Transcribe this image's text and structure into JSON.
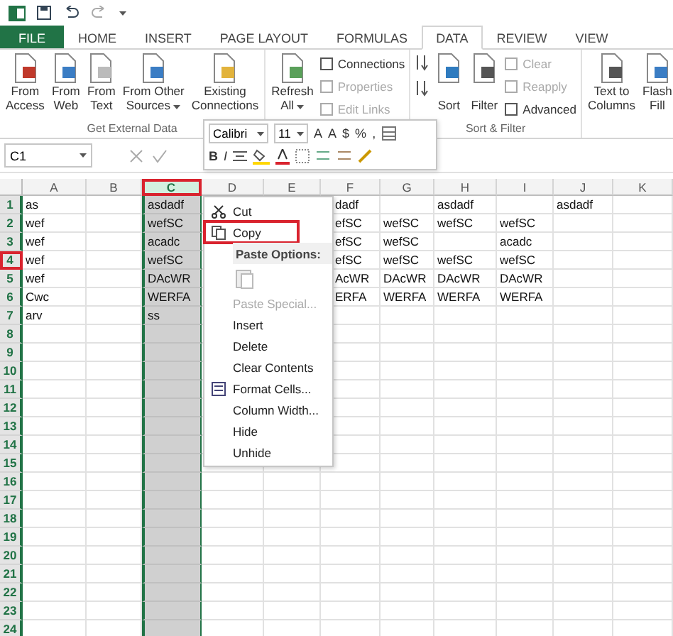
{
  "tabs": [
    {
      "label": "FILE",
      "kind": "file",
      "selected": false
    },
    {
      "label": "HOME",
      "kind": "tab",
      "selected": false
    },
    {
      "label": "INSERT",
      "kind": "tab",
      "selected": false
    },
    {
      "label": "PAGE LAYOUT",
      "kind": "tab",
      "selected": false
    },
    {
      "label": "FORMULAS",
      "kind": "tab",
      "selected": false
    },
    {
      "label": "DATA",
      "kind": "tab",
      "selected": true
    },
    {
      "label": "REVIEW",
      "kind": "tab",
      "selected": false
    },
    {
      "label": "VIEW",
      "kind": "tab",
      "selected": false
    }
  ],
  "ribbon": [
    {
      "label": "Get External Data",
      "items": [
        {
          "kind": "large",
          "lines": [
            "From",
            "Access"
          ],
          "dropdown": false
        },
        {
          "kind": "large",
          "lines": [
            "From",
            "Web"
          ],
          "dropdown": false
        },
        {
          "kind": "large",
          "lines": [
            "From",
            "Text"
          ],
          "dropdown": false
        },
        {
          "kind": "large",
          "lines": [
            "From Other",
            "Sources"
          ],
          "dropdown": true
        },
        {
          "kind": "large",
          "lines": [
            "Existing",
            "Connections"
          ],
          "dropdown": false
        }
      ]
    },
    {
      "items": [
        {
          "kind": "large",
          "lines": [
            "Refresh",
            "All"
          ],
          "dropdown": true
        },
        {
          "kind": "stack",
          "entries": [
            {
              "label": "Connections",
              "disabled": false
            },
            {
              "label": "Properties",
              "disabled": true
            },
            {
              "label": "Edit Links",
              "disabled": true
            }
          ]
        }
      ]
    },
    {
      "label": "Sort & Filter",
      "items": [
        {
          "kind": "sortpair"
        },
        {
          "kind": "large",
          "lines": [
            "Sort"
          ],
          "dropdown": false
        },
        {
          "kind": "large",
          "lines": [
            "Filter"
          ],
          "dropdown": false
        },
        {
          "kind": "stack",
          "entries": [
            {
              "label": "Clear",
              "disabled": true
            },
            {
              "label": "Reapply",
              "disabled": true
            },
            {
              "label": "Advanced",
              "disabled": false
            }
          ]
        }
      ]
    },
    {
      "items": [
        {
          "kind": "large",
          "lines": [
            "Text to",
            "Columns"
          ],
          "dropdown": false
        },
        {
          "kind": "large",
          "lines": [
            "Flash",
            "Fill"
          ],
          "dropdown": false
        }
      ]
    }
  ],
  "name_box": "C1",
  "mini_toolbar": {
    "font": "Calibri",
    "size": "11",
    "grow": [
      "A",
      "A"
    ],
    "symbols": [
      "$",
      "%",
      ","
    ],
    "styles": [
      "B",
      "I"
    ]
  },
  "columns": [
    {
      "label": "A",
      "selected": false,
      "highlighted": false
    },
    {
      "label": "B",
      "selected": false,
      "highlighted": false
    },
    {
      "label": "C",
      "selected": true,
      "highlighted": true
    },
    {
      "label": "D",
      "selected": false,
      "highlighted": false
    },
    {
      "label": "E",
      "selected": false,
      "highlighted": false
    },
    {
      "label": "F",
      "selected": false,
      "highlighted": false
    },
    {
      "label": "G",
      "selected": false,
      "highlighted": false
    },
    {
      "label": "H",
      "selected": false,
      "highlighted": false
    },
    {
      "label": "I",
      "selected": false,
      "highlighted": false
    },
    {
      "label": "J",
      "selected": false,
      "highlighted": false
    },
    {
      "label": "K",
      "selected": false,
      "highlighted": false
    }
  ],
  "rows": [
    {
      "number": "1",
      "highlighted": false,
      "cells": {
        "a": "as",
        "c": "asdadf",
        "f": "dadf",
        "h": "asdadf",
        "j": "asdadf"
      }
    },
    {
      "number": "2",
      "highlighted": false,
      "cells": {
        "a": "wef",
        "c": "wefSC",
        "f": "efSC",
        "g": "wefSC",
        "h": "wefSC",
        "i": "wefSC"
      }
    },
    {
      "number": "3",
      "highlighted": false,
      "cells": {
        "a": "wef",
        "c": "acadc",
        "f": "efSC",
        "g": "wefSC",
        "i": "acadc"
      }
    },
    {
      "number": "4",
      "highlighted": true,
      "cells": {
        "a": "wef",
        "c": "wefSC",
        "f": "efSC",
        "g": "wefSC",
        "h": "wefSC",
        "i": "wefSC"
      }
    },
    {
      "number": "5",
      "highlighted": false,
      "cells": {
        "a": "wef",
        "c": "DAcWR",
        "f": "AcWR",
        "g": "DAcWR",
        "h": "DAcWR",
        "i": "DAcWR"
      }
    },
    {
      "number": "6",
      "highlighted": false,
      "cells": {
        "a": "Cwc",
        "c": "WERFA",
        "f": "ERFA",
        "g": "WERFA",
        "h": "WERFA",
        "i": "WERFA"
      }
    },
    {
      "number": "7",
      "highlighted": false,
      "cells": {
        "a": "arv",
        "c": "ss"
      }
    },
    {
      "number": "8",
      "highlighted": false,
      "cells": {}
    },
    {
      "number": "9",
      "highlighted": false,
      "cells": {}
    },
    {
      "number": "10",
      "highlighted": false,
      "cells": {}
    },
    {
      "number": "11",
      "highlighted": false,
      "cells": {}
    },
    {
      "number": "12",
      "highlighted": false,
      "cells": {}
    },
    {
      "number": "13",
      "highlighted": false,
      "cells": {}
    },
    {
      "number": "14",
      "highlighted": false,
      "cells": {}
    },
    {
      "number": "15",
      "highlighted": false,
      "cells": {}
    },
    {
      "number": "16",
      "highlighted": false,
      "cells": {}
    },
    {
      "number": "17",
      "highlighted": false,
      "cells": {}
    },
    {
      "number": "18",
      "highlighted": false,
      "cells": {}
    },
    {
      "number": "19",
      "highlighted": false,
      "cells": {}
    },
    {
      "number": "20",
      "highlighted": false,
      "cells": {}
    },
    {
      "number": "21",
      "highlighted": false,
      "cells": {}
    },
    {
      "number": "22",
      "highlighted": false,
      "cells": {}
    },
    {
      "number": "23",
      "highlighted": false,
      "cells": {}
    },
    {
      "number": "24",
      "highlighted": false,
      "cells": {}
    }
  ],
  "context_menu": [
    {
      "kind": "command",
      "label": "Cut",
      "disabled": false,
      "highlighted": false
    },
    {
      "kind": "command",
      "label": "Copy",
      "disabled": false,
      "highlighted": true
    },
    {
      "kind": "header",
      "label": "Paste Options:"
    },
    {
      "kind": "paste"
    },
    {
      "kind": "command",
      "label": "Paste Special...",
      "disabled": true,
      "highlighted": false
    },
    {
      "kind": "command",
      "label": "Insert",
      "disabled": false,
      "highlighted": false
    },
    {
      "kind": "command",
      "label": "Delete",
      "disabled": false,
      "highlighted": false
    },
    {
      "kind": "command",
      "label": "Clear Contents",
      "disabled": false,
      "highlighted": false
    },
    {
      "kind": "command",
      "label": "Format Cells...",
      "disabled": false,
      "highlighted": false
    },
    {
      "kind": "command",
      "label": "Column Width...",
      "disabled": false,
      "highlighted": false
    },
    {
      "kind": "command",
      "label": "Hide",
      "disabled": false,
      "highlighted": false
    },
    {
      "kind": "command",
      "label": "Unhide",
      "disabled": false,
      "highlighted": false
    }
  ]
}
